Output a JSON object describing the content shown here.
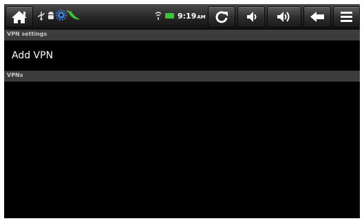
{
  "status_bar": {
    "clock_time": "9:19",
    "clock_ampm": "AM",
    "accent_green": "#3fc23a",
    "notification_icons": [
      "usb-icon",
      "android-icon",
      "gear-icon",
      "chili-pepper-icon"
    ],
    "system_icons": [
      "wifi-icon",
      "battery-icon"
    ],
    "buttons": [
      "home-icon",
      "refresh-icon",
      "volume-down-icon",
      "volume-up-icon",
      "back-icon",
      "menu-icon"
    ]
  },
  "settings": {
    "section_title": "VPN settings",
    "add_vpn_label": "Add VPN",
    "vpns_header": "VPNs"
  }
}
